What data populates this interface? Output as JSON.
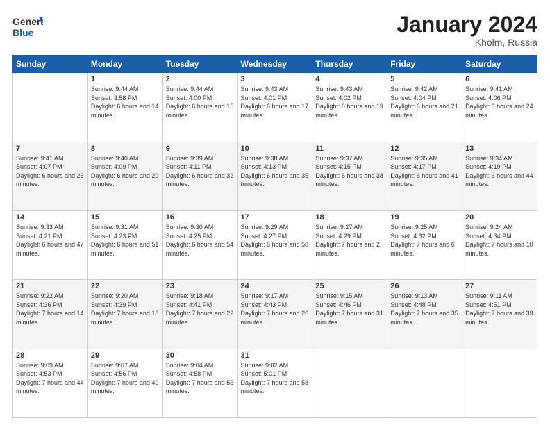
{
  "header": {
    "logo_general": "General",
    "logo_blue": "Blue",
    "month_title": "January 2024",
    "location": "Kholm, Russia"
  },
  "days_of_week": [
    "Sunday",
    "Monday",
    "Tuesday",
    "Wednesday",
    "Thursday",
    "Friday",
    "Saturday"
  ],
  "weeks": [
    [
      {
        "day": "",
        "sunrise": "",
        "sunset": "",
        "daylight": ""
      },
      {
        "day": "1",
        "sunrise": "9:44 AM",
        "sunset": "3:58 PM",
        "daylight": "6 hours and 14 minutes."
      },
      {
        "day": "2",
        "sunrise": "9:44 AM",
        "sunset": "4:00 PM",
        "daylight": "6 hours and 15 minutes."
      },
      {
        "day": "3",
        "sunrise": "9:43 AM",
        "sunset": "4:01 PM",
        "daylight": "6 hours and 17 minutes."
      },
      {
        "day": "4",
        "sunrise": "9:43 AM",
        "sunset": "4:02 PM",
        "daylight": "6 hours and 19 minutes."
      },
      {
        "day": "5",
        "sunrise": "9:42 AM",
        "sunset": "4:04 PM",
        "daylight": "6 hours and 21 minutes."
      },
      {
        "day": "6",
        "sunrise": "9:41 AM",
        "sunset": "4:06 PM",
        "daylight": "6 hours and 24 minutes."
      }
    ],
    [
      {
        "day": "7",
        "sunrise": "9:41 AM",
        "sunset": "4:07 PM",
        "daylight": "6 hours and 26 minutes."
      },
      {
        "day": "8",
        "sunrise": "9:40 AM",
        "sunset": "4:09 PM",
        "daylight": "6 hours and 29 minutes."
      },
      {
        "day": "9",
        "sunrise": "9:39 AM",
        "sunset": "4:11 PM",
        "daylight": "6 hours and 32 minutes."
      },
      {
        "day": "10",
        "sunrise": "9:38 AM",
        "sunset": "4:13 PM",
        "daylight": "6 hours and 35 minutes."
      },
      {
        "day": "11",
        "sunrise": "9:37 AM",
        "sunset": "4:15 PM",
        "daylight": "6 hours and 38 minutes."
      },
      {
        "day": "12",
        "sunrise": "9:35 AM",
        "sunset": "4:17 PM",
        "daylight": "6 hours and 41 minutes."
      },
      {
        "day": "13",
        "sunrise": "9:34 AM",
        "sunset": "4:19 PM",
        "daylight": "6 hours and 44 minutes."
      }
    ],
    [
      {
        "day": "14",
        "sunrise": "9:33 AM",
        "sunset": "4:21 PM",
        "daylight": "6 hours and 47 minutes."
      },
      {
        "day": "15",
        "sunrise": "9:31 AM",
        "sunset": "4:23 PM",
        "daylight": "6 hours and 51 minutes."
      },
      {
        "day": "16",
        "sunrise": "9:30 AM",
        "sunset": "4:25 PM",
        "daylight": "6 hours and 54 minutes."
      },
      {
        "day": "17",
        "sunrise": "9:29 AM",
        "sunset": "4:27 PM",
        "daylight": "6 hours and 58 minutes."
      },
      {
        "day": "18",
        "sunrise": "9:27 AM",
        "sunset": "4:29 PM",
        "daylight": "7 hours and 2 minutes."
      },
      {
        "day": "19",
        "sunrise": "9:25 AM",
        "sunset": "4:32 PM",
        "daylight": "7 hours and 6 minutes."
      },
      {
        "day": "20",
        "sunrise": "9:24 AM",
        "sunset": "4:34 PM",
        "daylight": "7 hours and 10 minutes."
      }
    ],
    [
      {
        "day": "21",
        "sunrise": "9:22 AM",
        "sunset": "4:36 PM",
        "daylight": "7 hours and 14 minutes."
      },
      {
        "day": "22",
        "sunrise": "9:20 AM",
        "sunset": "4:39 PM",
        "daylight": "7 hours and 18 minutes."
      },
      {
        "day": "23",
        "sunrise": "9:18 AM",
        "sunset": "4:41 PM",
        "daylight": "7 hours and 22 minutes."
      },
      {
        "day": "24",
        "sunrise": "9:17 AM",
        "sunset": "4:43 PM",
        "daylight": "7 hours and 26 minutes."
      },
      {
        "day": "25",
        "sunrise": "9:15 AM",
        "sunset": "4:46 PM",
        "daylight": "7 hours and 31 minutes."
      },
      {
        "day": "26",
        "sunrise": "9:13 AM",
        "sunset": "4:48 PM",
        "daylight": "7 hours and 35 minutes."
      },
      {
        "day": "27",
        "sunrise": "9:11 AM",
        "sunset": "4:51 PM",
        "daylight": "7 hours and 39 minutes."
      }
    ],
    [
      {
        "day": "28",
        "sunrise": "9:09 AM",
        "sunset": "4:53 PM",
        "daylight": "7 hours and 44 minutes."
      },
      {
        "day": "29",
        "sunrise": "9:07 AM",
        "sunset": "4:56 PM",
        "daylight": "7 hours and 49 minutes."
      },
      {
        "day": "30",
        "sunrise": "9:04 AM",
        "sunset": "4:58 PM",
        "daylight": "7 hours and 53 minutes."
      },
      {
        "day": "31",
        "sunrise": "9:02 AM",
        "sunset": "5:01 PM",
        "daylight": "7 hours and 58 minutes."
      },
      {
        "day": "",
        "sunrise": "",
        "sunset": "",
        "daylight": ""
      },
      {
        "day": "",
        "sunrise": "",
        "sunset": "",
        "daylight": ""
      },
      {
        "day": "",
        "sunrise": "",
        "sunset": "",
        "daylight": ""
      }
    ]
  ]
}
